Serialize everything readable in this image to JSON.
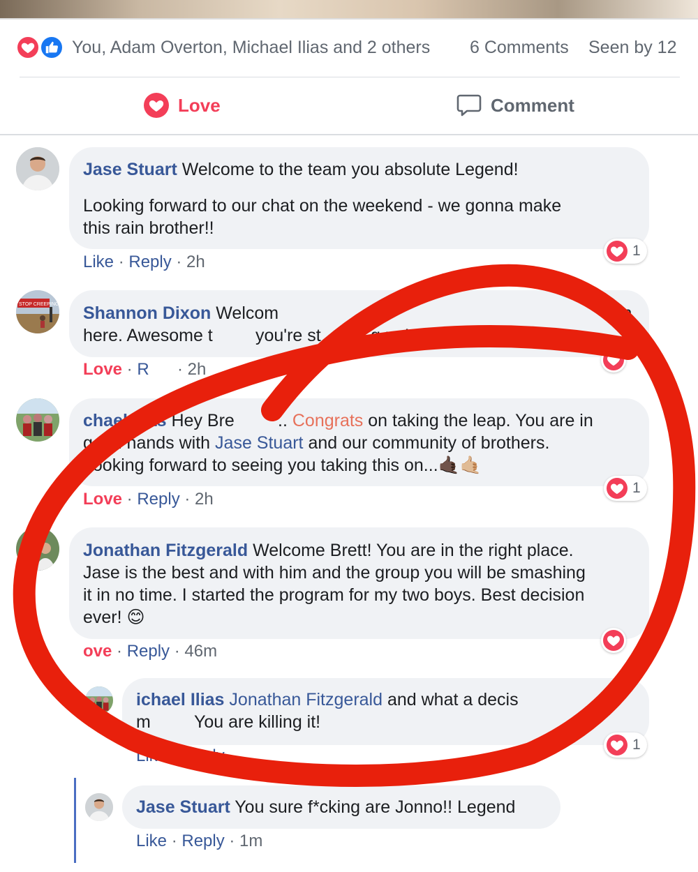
{
  "summary": {
    "reaction_icons": [
      "heart-icon",
      "like-icon"
    ],
    "names": "You, Adam Overton, Michael Ilias and 2 others",
    "comments": "6 Comments",
    "seen": "Seen by 12"
  },
  "actions": {
    "love_label": "Love",
    "comment_label": "Comment"
  },
  "colors": {
    "love": "#f33e58",
    "link": "#385898",
    "circle_annotation": "#e8200c"
  },
  "comments": [
    {
      "author": "Jase Stuart",
      "line1": "Welcome to the team you absolute Legend!",
      "line2": "Looking forward to our chat on the weekend - we gonna make",
      "line3": "this rain brother!!",
      "action1": "Like",
      "action2": "Reply",
      "time": "2h",
      "reaction_count": "1"
    },
    {
      "author": "Shannon Dixon",
      "line1_a": "Welcom",
      "line1_b": "in",
      "line2_a": "here. Awesome t",
      "line2_b": "you're st",
      "line2_c": "g up!",
      "action1": "Love",
      "action2_partial": "R",
      "time_partial": "· 2h",
      "avatar_sign": "STOP CREEPING"
    },
    {
      "author_visible": "chael Ilias",
      "line1_a": "Hey Bre",
      "line1_b": "..",
      "line1_c": "Congrats",
      "line1_d": "on taking the leap. You are in",
      "line2_a": "good hands with",
      "line2_link": "Jase Stuart",
      "line2_b": "and our community of brothers.",
      "line3": "Looking forward to seeing you taking this on...",
      "emoji": "🤙🏿🤙🏼",
      "action1": "Love",
      "action2": "Reply",
      "time": "2h",
      "reaction_count": "1"
    },
    {
      "author": "Jonathan Fitzgerald",
      "line1": "Welcome Brett! You are in the right place.",
      "line2": "Jase is the best and with him and the group you will be smashing",
      "line3": "it in no time. I started the program for my two boys. Best decision",
      "line4": "ever!",
      "emoji": "😊",
      "action1_partial": "ove",
      "action2": "Reply",
      "time": "46m"
    },
    {
      "author_visible": "ichael Ilias",
      "mention": "Jonathan Fitzgerald",
      "line1_rest": "and what a decis",
      "line2_a": "m",
      "line2_b": "You are killing it!",
      "action1": "Like",
      "action2_partial": "Reply",
      "reaction_count": "1"
    },
    {
      "author": "Jase Stuart",
      "text": "You sure f*cking are Jonno!! Legend",
      "action1": "Like",
      "action2": "Reply",
      "time": "1m"
    }
  ]
}
